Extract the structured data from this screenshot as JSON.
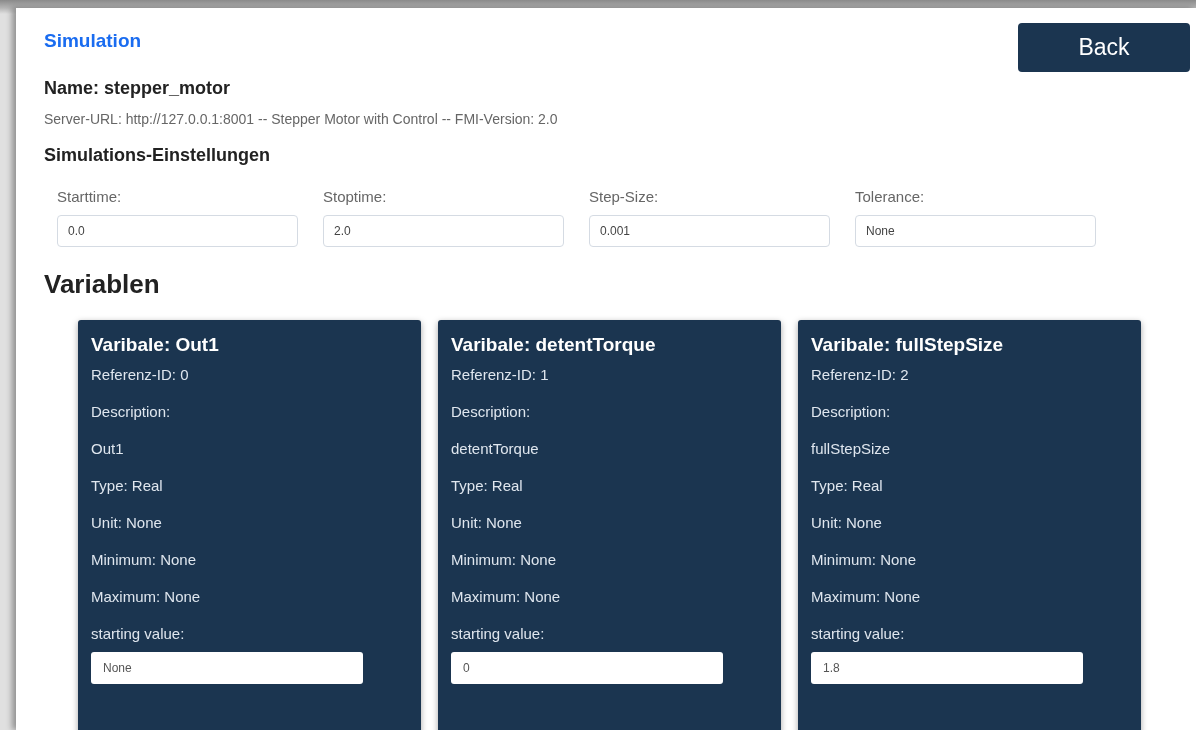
{
  "page_link": "Simulation",
  "back_button": "Back",
  "name": "Name: stepper_motor",
  "server_info": "Server-URL: http://127.0.0.1:8001 -- Stepper Motor with Control -- FMI-Version: 2.0",
  "settings_heading": "Simulations-Einstellungen",
  "settings": [
    {
      "label": "Starttime:",
      "value": "0.0"
    },
    {
      "label": "Stoptime:",
      "value": "2.0"
    },
    {
      "label": "Step-Size:",
      "value": "0.001"
    },
    {
      "label": "Tolerance:",
      "value": "None"
    }
  ],
  "variables_heading": "Variablen",
  "variables": [
    {
      "title": "Varibale: Out1",
      "lines": [
        "Referenz-ID: 0",
        "Description:",
        "Out1",
        "Type: Real",
        "Unit: None",
        "Minimum: None",
        "Maximum: None"
      ],
      "start_label": "starting value:",
      "start_value": "None"
    },
    {
      "title": "Varibale: detentTorque",
      "lines": [
        "Referenz-ID: 1",
        "Description:",
        "detentTorque",
        "Type: Real",
        "Unit: None",
        "Minimum: None",
        "Maximum: None"
      ],
      "start_label": "starting value:",
      "start_value": "0"
    },
    {
      "title": "Varibale: fullStepSize",
      "lines": [
        "Referenz-ID: 2",
        "Description:",
        "fullStepSize",
        "Type: Real",
        "Unit: None",
        "Minimum: None",
        "Maximum: None"
      ],
      "start_label": "starting value:",
      "start_value": "1.8"
    }
  ]
}
